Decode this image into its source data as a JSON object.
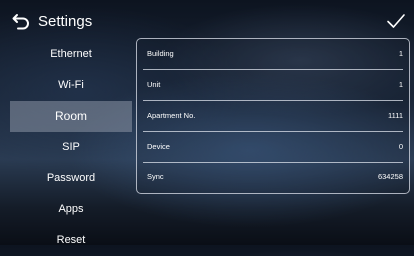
{
  "header": {
    "title": "Settings"
  },
  "sidebar": {
    "items": [
      {
        "label": "Ethernet"
      },
      {
        "label": "Wi-Fi"
      },
      {
        "label": "Room"
      },
      {
        "label": "SIP"
      },
      {
        "label": "Password"
      },
      {
        "label": "Apps"
      },
      {
        "label": "Reset"
      }
    ],
    "active": "Room"
  },
  "room": {
    "rows": [
      {
        "label": "Building",
        "value": "1"
      },
      {
        "label": "Unit",
        "value": "1"
      },
      {
        "label": "Apartment No.",
        "value": "1111"
      },
      {
        "label": "Device",
        "value": "0"
      },
      {
        "label": "Sync",
        "value": "634258"
      }
    ]
  },
  "icons": {
    "back": "back-arrow-icon",
    "confirm": "checkmark-icon"
  }
}
